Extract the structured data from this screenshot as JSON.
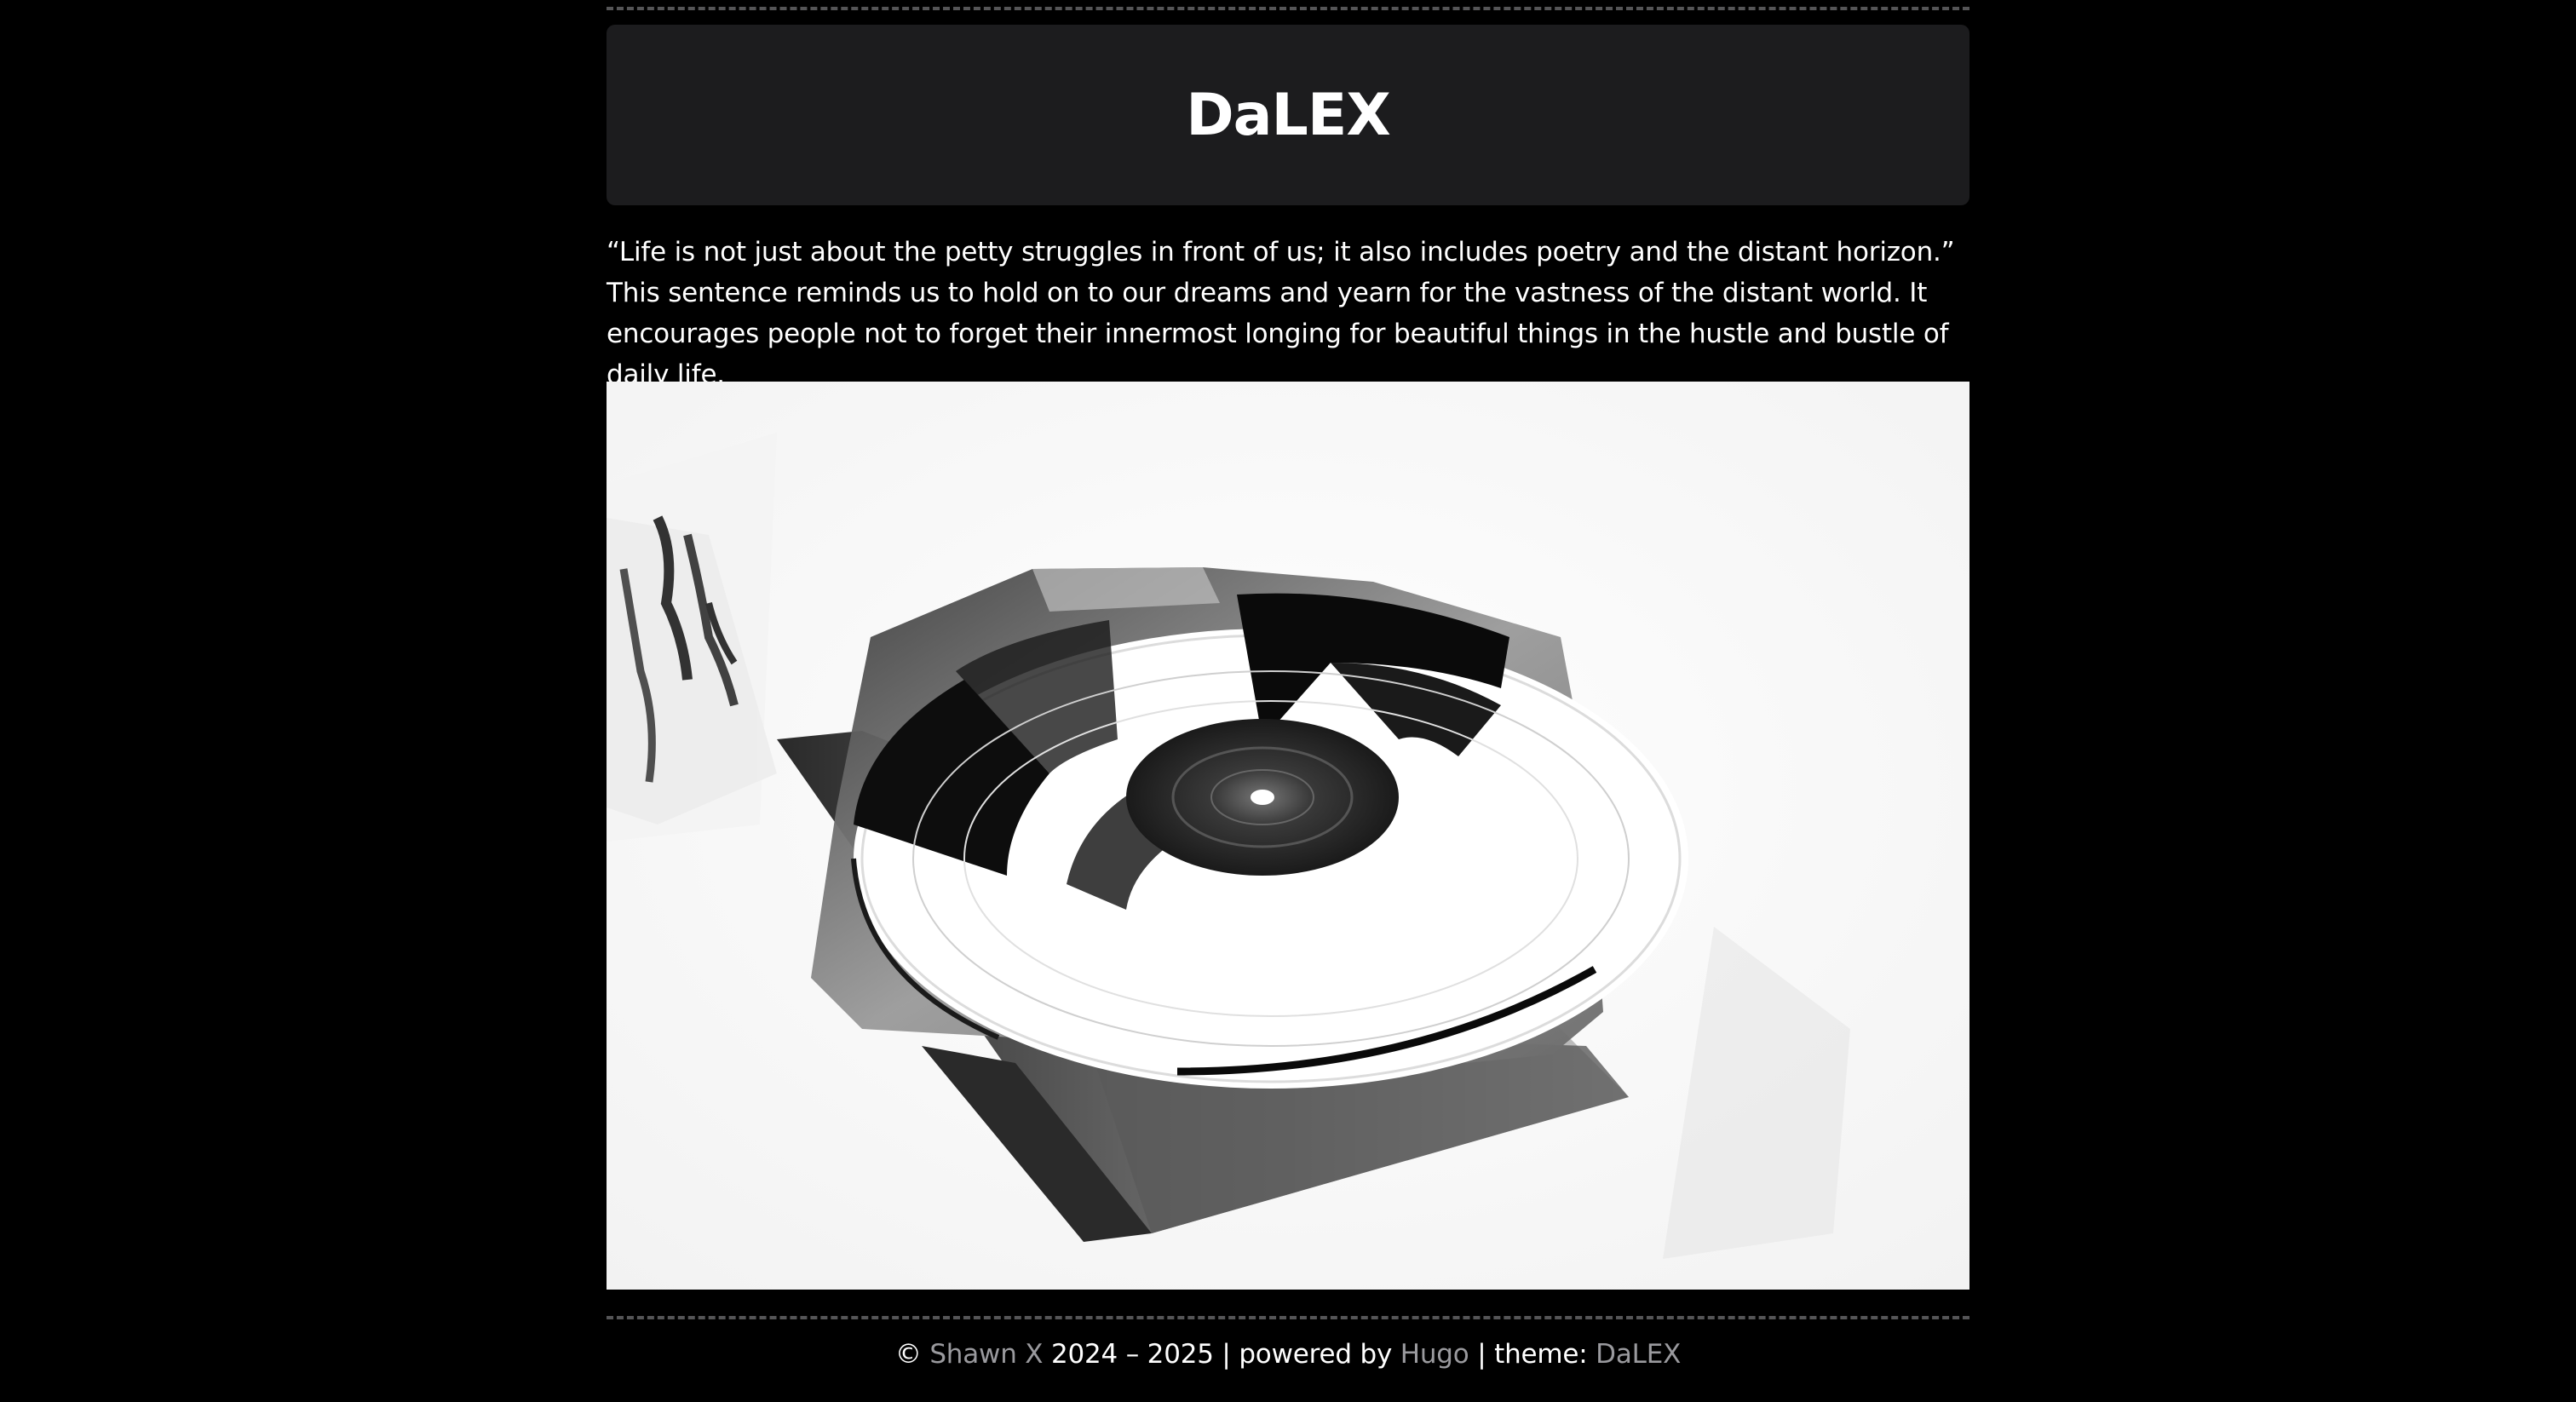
{
  "header": {
    "site_title": "DaLEX"
  },
  "quote": {
    "text": "“Life is not just about the petty struggles in front of us; it also includes poetry and the distant horizon.” This sentence reminds us to hold on to our dreams and yearn for the vastness of the distant world. It encourages people not to forget their innermost longing for beautiful things in the hustle and bustle of daily life."
  },
  "photo": {
    "subject": "vinyl-record-icon"
  },
  "footer": {
    "copyright_symbol": "©",
    "author_link": "Shawn X",
    "years_text": "2024 – 2025 | powered by",
    "hugo_link": "Hugo",
    "theme_text": "| theme:",
    "theme_link": "DaLEX"
  },
  "colors": {
    "background": "#000000",
    "header_bg": "#1c1c1e",
    "text": "#ffffff",
    "link": "#9a9a9e",
    "divider": "#555557"
  }
}
